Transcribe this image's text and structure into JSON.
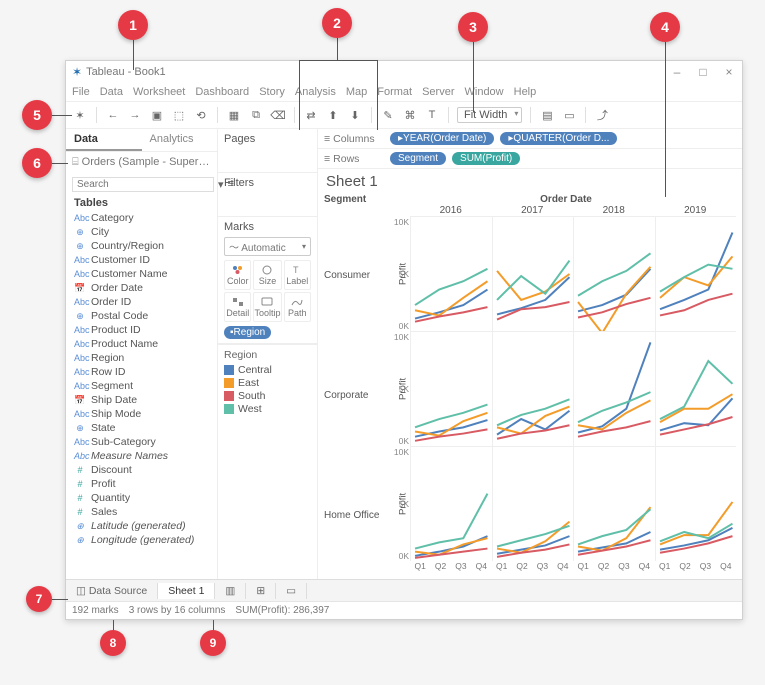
{
  "callouts": [
    "1",
    "2",
    "3",
    "4",
    "5",
    "6",
    "7",
    "8",
    "9"
  ],
  "window": {
    "app_icon": "tableau-logo",
    "title": "Tableau - Book1",
    "win_buttons": {
      "min": "–",
      "max": "□",
      "close": "×"
    }
  },
  "menubar": [
    "File",
    "Data",
    "Worksheet",
    "Dashboard",
    "Story",
    "Analysis",
    "Map",
    "Format",
    "Server",
    "Window",
    "Help"
  ],
  "toolbar": {
    "fit_label": "Fit Width"
  },
  "sidebar": {
    "tabs": {
      "data": "Data",
      "analytics": "Analytics"
    },
    "datasource": "Orders (Sample - Superst...",
    "search_placeholder": "Search",
    "tables_label": "Tables",
    "fields": [
      {
        "icon": "abc",
        "label": "Category"
      },
      {
        "icon": "geo",
        "label": "City"
      },
      {
        "icon": "geo",
        "label": "Country/Region"
      },
      {
        "icon": "abc",
        "label": "Customer ID"
      },
      {
        "icon": "abc",
        "label": "Customer Name"
      },
      {
        "icon": "date",
        "label": "Order Date"
      },
      {
        "icon": "abc",
        "label": "Order ID"
      },
      {
        "icon": "geo",
        "label": "Postal Code"
      },
      {
        "icon": "abc",
        "label": "Product ID"
      },
      {
        "icon": "abc",
        "label": "Product Name"
      },
      {
        "icon": "abc",
        "label": "Region"
      },
      {
        "icon": "abc",
        "label": "Row ID"
      },
      {
        "icon": "abc",
        "label": "Segment"
      },
      {
        "icon": "date",
        "label": "Ship Date"
      },
      {
        "icon": "abc",
        "label": "Ship Mode"
      },
      {
        "icon": "geo",
        "label": "State"
      },
      {
        "icon": "abc",
        "label": "Sub-Category"
      },
      {
        "icon": "abc",
        "label": "Measure Names",
        "italic": true
      },
      {
        "icon": "num",
        "label": "Discount"
      },
      {
        "icon": "num",
        "label": "Profit"
      },
      {
        "icon": "num",
        "label": "Quantity"
      },
      {
        "icon": "num",
        "label": "Sales"
      },
      {
        "icon": "geo",
        "label": "Latitude (generated)",
        "italic": true
      },
      {
        "icon": "geo",
        "label": "Longitude (generated)",
        "italic": true
      }
    ]
  },
  "cards": {
    "pages": "Pages",
    "filters": "Filters",
    "marks": "Marks",
    "mark_type": "Automatic",
    "cells": {
      "color": "Color",
      "size": "Size",
      "label": "Label",
      "detail": "Detail",
      "tooltip": "Tooltip",
      "path": "Path"
    },
    "color_pill": "Region"
  },
  "legend": {
    "title": "Region",
    "items": [
      {
        "name": "Central",
        "color": "#4f81bd"
      },
      {
        "name": "East",
        "color": "#f39c2a"
      },
      {
        "name": "South",
        "color": "#d85a62"
      },
      {
        "name": "West",
        "color": "#5fbfa8"
      }
    ]
  },
  "shelves": {
    "columns_label": "Columns",
    "rows_label": "Rows",
    "columns": [
      {
        "text": "YEAR(Order Date)",
        "cls": "blue"
      },
      {
        "text": "QUARTER(Order D...",
        "cls": "blue"
      }
    ],
    "rows": [
      {
        "text": "Segment",
        "cls": "blue"
      },
      {
        "text": "SUM(Profit)",
        "cls": "teal"
      }
    ]
  },
  "sheet": {
    "title": "Sheet 1",
    "facet_title": "Order Date",
    "segment_header": "Segment",
    "years": [
      "2016",
      "2017",
      "2018",
      "2019"
    ],
    "segments": [
      "Consumer",
      "Corporate",
      "Home Office"
    ],
    "y_axis_label": "Profit",
    "y_ticks": [
      "10K",
      "5K",
      "0K"
    ],
    "x_ticks": [
      "Q1",
      "Q2",
      "Q3",
      "Q4"
    ]
  },
  "chart_data": {
    "type": "line",
    "facet_cols": [
      "2016",
      "2017",
      "2018",
      "2019"
    ],
    "facet_rows": [
      "Consumer",
      "Corporate",
      "Home Office"
    ],
    "x": [
      "Q1",
      "Q2",
      "Q3",
      "Q4"
    ],
    "ylabel": "Profit",
    "ylim": [
      0,
      11000
    ],
    "series_colors": {
      "Central": "#4f81bd",
      "East": "#f39c2a",
      "South": "#d85a62",
      "West": "#5fbfa8"
    },
    "panels": {
      "Consumer": {
        "2016": {
          "Central": [
            1200,
            1800,
            2500,
            4000
          ],
          "East": [
            2000,
            1500,
            3200,
            4800
          ],
          "South": [
            900,
            1400,
            1800,
            2300
          ],
          "West": [
            2500,
            4000,
            4800,
            6000
          ]
        },
        "2017": {
          "Central": [
            1600,
            2200,
            3000,
            5200
          ],
          "East": [
            5800,
            3000,
            3800,
            5500
          ],
          "South": [
            1100,
            2100,
            2300,
            2800
          ],
          "West": [
            3000,
            5300,
            3600,
            6800
          ]
        },
        "2018": {
          "Central": [
            1900,
            2500,
            3500,
            6000
          ],
          "East": [
            2800,
            -200,
            3600,
            6200
          ],
          "South": [
            1300,
            1800,
            2600,
            3200
          ],
          "West": [
            3400,
            4800,
            5800,
            7500
          ]
        },
        "2019": {
          "Central": [
            2100,
            3000,
            4000,
            9500
          ],
          "East": [
            3200,
            5200,
            4400,
            7200
          ],
          "South": [
            1500,
            2000,
            3000,
            3600
          ],
          "West": [
            3800,
            5200,
            6400,
            6000
          ]
        }
      },
      "Corporate": {
        "2016": {
          "Central": [
            900,
            1400,
            1800,
            2500
          ],
          "East": [
            1400,
            1000,
            2400,
            3200
          ],
          "South": [
            500,
            900,
            1200,
            1600
          ],
          "West": [
            1800,
            2600,
            3200,
            4000
          ]
        },
        "2017": {
          "Central": [
            1100,
            2600,
            1600,
            3400
          ],
          "East": [
            1800,
            1200,
            2900,
            3800
          ],
          "South": [
            700,
            1200,
            1500,
            2000
          ],
          "West": [
            2000,
            3000,
            3600,
            4500
          ]
        },
        "2018": {
          "Central": [
            1300,
            1900,
            3600,
            10000
          ],
          "East": [
            2000,
            1600,
            3200,
            4400
          ],
          "South": [
            900,
            1400,
            1800,
            2400
          ],
          "West": [
            2300,
            3400,
            4200,
            5200
          ]
        },
        "2019": {
          "Central": [
            1500,
            2200,
            2000,
            4600
          ],
          "East": [
            2300,
            3600,
            3600,
            5000
          ],
          "South": [
            1100,
            1600,
            2100,
            2800
          ],
          "West": [
            2600,
            3800,
            8200,
            6000
          ]
        }
      },
      "Home Office": {
        "2016": {
          "Central": [
            500,
            900,
            1400,
            2400
          ],
          "East": [
            900,
            600,
            1600,
            2200
          ],
          "South": [
            300,
            600,
            900,
            1200
          ],
          "West": [
            1200,
            1800,
            2200,
            6500
          ]
        },
        "2017": {
          "Central": [
            700,
            1100,
            1500,
            2400
          ],
          "East": [
            1200,
            800,
            1900,
            3800
          ],
          "South": [
            400,
            800,
            1100,
            1600
          ],
          "West": [
            1400,
            2000,
            2600,
            3400
          ]
        },
        "2018": {
          "Central": [
            900,
            1300,
            1700,
            2800
          ],
          "East": [
            1400,
            1000,
            2200,
            5200
          ],
          "South": [
            600,
            1000,
            1400,
            2000
          ],
          "West": [
            1600,
            2400,
            3000,
            5000
          ]
        },
        "2019": {
          "Central": [
            1100,
            1500,
            2000,
            3200
          ],
          "East": [
            1600,
            2500,
            2500,
            5700
          ],
          "South": [
            800,
            1200,
            1700,
            2400
          ],
          "West": [
            1900,
            2800,
            2200,
            3600
          ]
        }
      }
    }
  },
  "bottom": {
    "datasource": "Data Source",
    "sheet": "Sheet 1"
  },
  "status": {
    "marks": "192 marks",
    "dims": "3 rows by 16 columns",
    "sum": "SUM(Profit): 286,397"
  }
}
